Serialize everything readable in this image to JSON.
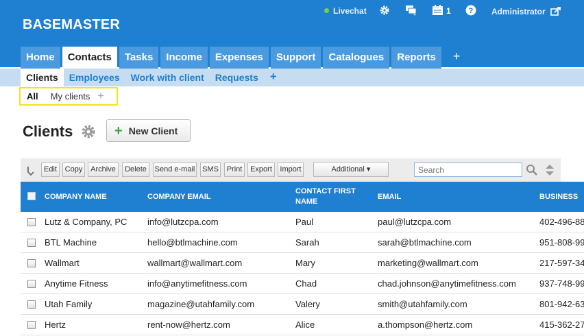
{
  "header": {
    "logo": "BASEMASTER",
    "livechat": "Livechat",
    "calendar_count": "1",
    "user": "Administrator"
  },
  "tabs": [
    "Home",
    "Contacts",
    "Tasks",
    "Income",
    "Expenses",
    "Support",
    "Catalogues",
    "Reports"
  ],
  "active_tab": "Contacts",
  "add_tab": "+",
  "subtabs": [
    "Clients",
    "Employees",
    "Work with client",
    "Requests"
  ],
  "add_subtab": "+",
  "filters": {
    "all": "All",
    "my": "My clients",
    "add": "+"
  },
  "page": {
    "title": "Clients",
    "new_button": "New Client"
  },
  "toolbar": {
    "buttons": [
      "Edit",
      "Copy",
      "Archive",
      "Delete",
      "Send e-mail",
      "SMS",
      "Print",
      "Export",
      "Import"
    ],
    "additional": "Additional ▾",
    "search_placeholder": "Search"
  },
  "table": {
    "columns": [
      "COMPANY NAME",
      "COMPANY EMAIL",
      "CONTACT FIRST NAME",
      "EMAIL",
      "BUSINESS"
    ],
    "rows": [
      [
        "Lutz & Company, PC",
        "info@lutzcpa.com",
        "Paul",
        "paul@lutzcpa.com",
        "402-496-88"
      ],
      [
        "BTL Machine",
        "hello@btlmachine.com",
        "Sarah",
        "sarah@btlmachine.com",
        "951-808-99"
      ],
      [
        "Wallmart",
        "wallmart@wallmart.com",
        "Mary",
        "marketing@wallmart.com",
        "217-597-34"
      ],
      [
        "Anytime Fitness",
        "info@anytimefitness.com",
        "Chad",
        "chad.johnson@anytimefitness.com",
        "937-748-99"
      ],
      [
        "Utah Family",
        "magazine@utahfamily.com",
        "Valery",
        "smith@utahfamily.com",
        "801-942-63"
      ],
      [
        "Hertz",
        "rent-now@hertz.com",
        "Alice",
        "a.thompson@hertz.com",
        "415-362-27"
      ]
    ]
  },
  "colors": {
    "brand": "#1f7fd0",
    "tab_inactive": "#4a9ae0",
    "subbar": "#c5dcf1",
    "highlight": "#f2e41c"
  }
}
